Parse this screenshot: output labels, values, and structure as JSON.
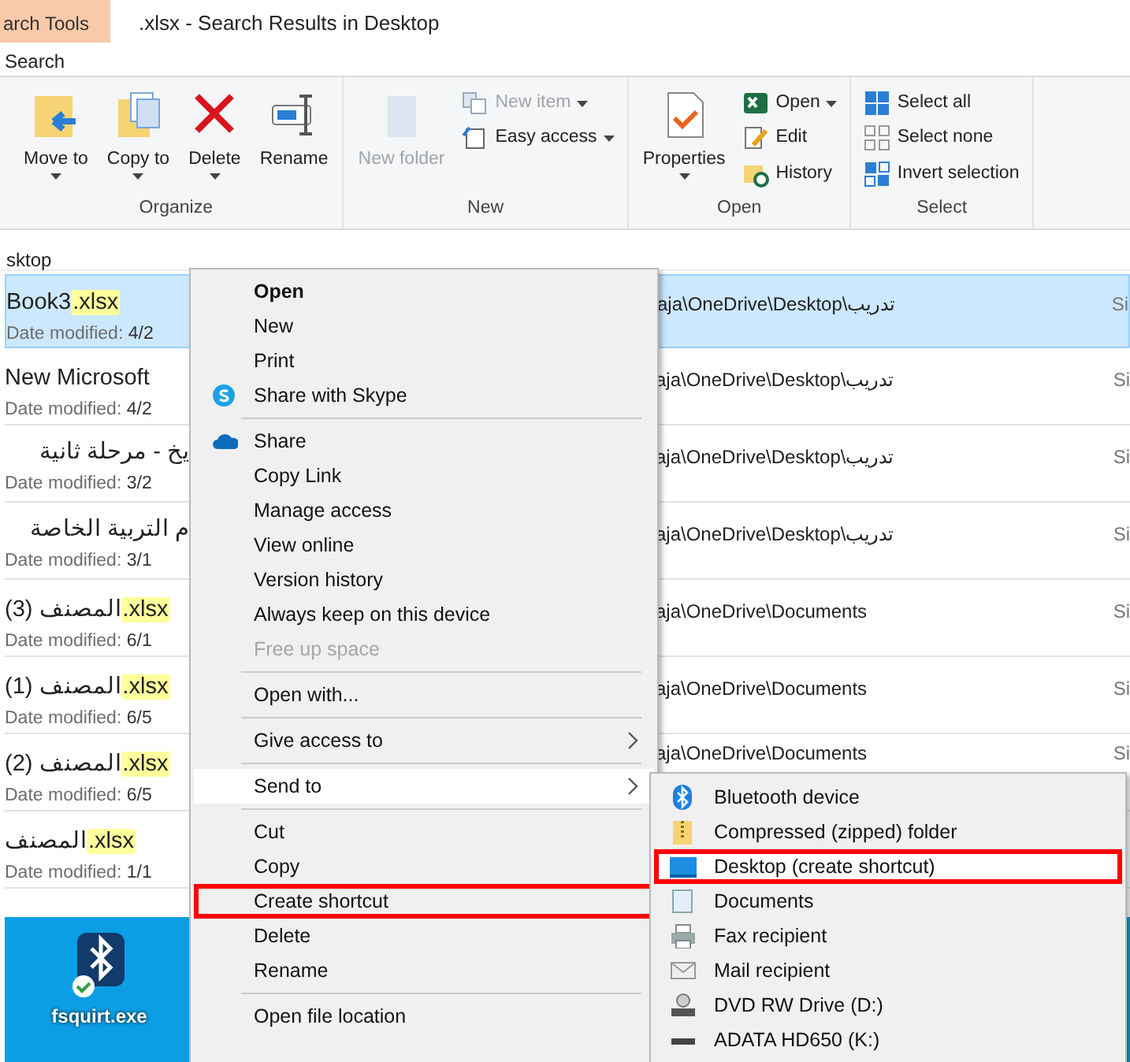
{
  "title_bar": {
    "tool_tab": "arch Tools",
    "title": ".xlsx - Search Results in Desktop",
    "ribbon_tab": "Search"
  },
  "ribbon": {
    "groups": [
      {
        "label": "Organize",
        "buttons": [
          {
            "kind": "large",
            "label": "Move to",
            "dropdown": true,
            "disabled": false
          },
          {
            "kind": "large",
            "label": "Copy to",
            "dropdown": true,
            "disabled": false
          },
          {
            "kind": "large",
            "label": "Delete",
            "dropdown": true,
            "disabled": false
          },
          {
            "kind": "large",
            "label": "Rename",
            "dropdown": false,
            "disabled": false
          }
        ]
      },
      {
        "label": "New",
        "buttons": [
          {
            "kind": "large",
            "label": "New folder",
            "dropdown": false,
            "disabled": true
          },
          {
            "kind": "small",
            "label": "New item",
            "dropdown": true,
            "disabled": true
          },
          {
            "kind": "small",
            "label": "Easy access",
            "dropdown": true,
            "disabled": false
          }
        ]
      },
      {
        "label": "Open",
        "buttons": [
          {
            "kind": "large",
            "label": "Properties",
            "dropdown": true,
            "disabled": false
          },
          {
            "kind": "small",
            "label": "Open",
            "dropdown": true,
            "disabled": false
          },
          {
            "kind": "small",
            "label": "Edit",
            "dropdown": false,
            "disabled": false
          },
          {
            "kind": "small",
            "label": "History",
            "dropdown": false,
            "disabled": false
          }
        ]
      },
      {
        "label": "Select",
        "buttons": [
          {
            "kind": "small",
            "label": "Select all",
            "dropdown": false,
            "disabled": false
          },
          {
            "kind": "small",
            "label": "Select none",
            "dropdown": false,
            "disabled": false
          },
          {
            "kind": "small",
            "label": "Invert selection",
            "dropdown": false,
            "disabled": false
          }
        ]
      }
    ]
  },
  "address": "sktop",
  "files": [
    {
      "name": "Book3",
      "match": ".xlsx",
      "date_label": "Date modified:",
      "date": "4/2",
      "path": "aja\\OneDrive\\Desktop\\تدريب",
      "column_3": "Si",
      "selected": true
    },
    {
      "name": "New Microsoft",
      "date_label": "Date modified:",
      "date": "4/2",
      "path": "aja\\OneDrive\\Desktop\\تدريب",
      "column_3": "Si",
      "selected": false
    },
    {
      "name": "يخ - مرحلة ثانية",
      "date_label": "Date modified:",
      "date": "3/2",
      "path": "aja\\OneDrive\\Desktop\\تدريب",
      "column_3": "Si",
      "selected": false
    },
    {
      "name": "م التربية الخاصة",
      "date_label": "Date modified:",
      "date": "3/1",
      "path": "aja\\OneDrive\\Desktop\\تدريب",
      "column_3": "Si",
      "selected": false
    },
    {
      "name": "المصنف (3)",
      "match": ".xlsx",
      "date_label": "Date modified:",
      "date": "6/1",
      "path": "aja\\OneDrive\\Documents",
      "column_3": "Si",
      "selected": false
    },
    {
      "name": "المصنف (1)",
      "match": ".xlsx",
      "date_label": "Date modified:",
      "date": "6/5",
      "path": "aja\\OneDrive\\Documents",
      "column_3": "Si",
      "selected": false
    },
    {
      "name": "المصنف (2)",
      "match": ".xlsx",
      "date_label": "Date modified:",
      "date": "6/5",
      "path": "aja\\OneDrive\\Documents",
      "column_3": "Si",
      "selected": false
    },
    {
      "name": "المصنف",
      "match": ".xlsx",
      "date_label": "Date modified:",
      "date": "1/1",
      "selected": false
    }
  ],
  "desktop_icons": [
    {
      "label": "fsquirt.exe"
    }
  ],
  "context_menu": {
    "items": [
      {
        "kind": "item",
        "label": "Open",
        "bold": true
      },
      {
        "kind": "item",
        "label": "New"
      },
      {
        "kind": "item",
        "label": "Print"
      },
      {
        "kind": "item",
        "label": "Share with Skype"
      },
      {
        "kind": "separator"
      },
      {
        "kind": "item",
        "label": "Share"
      },
      {
        "kind": "item",
        "label": "Copy Link"
      },
      {
        "kind": "item",
        "label": "Manage access"
      },
      {
        "kind": "item",
        "label": "View online"
      },
      {
        "kind": "item",
        "label": "Version history"
      },
      {
        "kind": "item",
        "label": "Always keep on this device"
      },
      {
        "kind": "item",
        "label": "Free up space",
        "disabled": true
      },
      {
        "kind": "separator"
      },
      {
        "kind": "item",
        "label": "Open with..."
      },
      {
        "kind": "separator"
      },
      {
        "kind": "submenu",
        "label": "Give access to"
      },
      {
        "kind": "separator"
      },
      {
        "kind": "submenu",
        "label": "Send to",
        "selected": true
      },
      {
        "kind": "separator"
      },
      {
        "kind": "item",
        "label": "Cut"
      },
      {
        "kind": "item",
        "label": "Copy"
      },
      {
        "kind": "item",
        "label": "Create shortcut",
        "annotated": true
      },
      {
        "kind": "item",
        "label": "Delete"
      },
      {
        "kind": "item",
        "label": "Rename"
      },
      {
        "kind": "separator"
      },
      {
        "kind": "item",
        "label": "Open file location"
      }
    ]
  },
  "send_to_menu": {
    "items": [
      {
        "label": "Bluetooth device"
      },
      {
        "label": "Compressed (zipped) folder"
      },
      {
        "label": "Desktop (create shortcut)",
        "selected": true,
        "annotated": true
      },
      {
        "label": "Documents"
      },
      {
        "label": "Fax recipient"
      },
      {
        "label": "Mail recipient"
      },
      {
        "label": "DVD RW Drive (D:)"
      },
      {
        "label": "ADATA HD650 (K:)"
      }
    ]
  }
}
